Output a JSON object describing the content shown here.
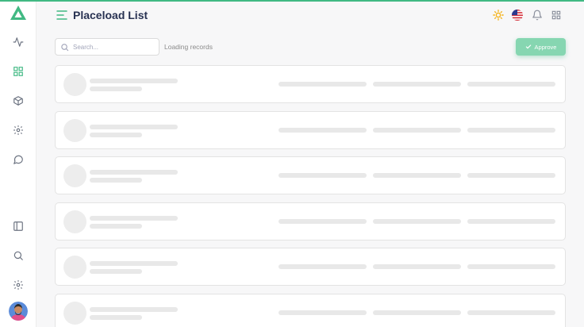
{
  "app": {
    "page_title": "Placeload List",
    "accent_color": "#41b983",
    "approve_color": "#86d6b1"
  },
  "sidebar": {
    "top_items": [
      {
        "icon": "activity-icon"
      },
      {
        "icon": "grid-icon"
      },
      {
        "icon": "box-icon"
      },
      {
        "icon": "settings-icon"
      },
      {
        "icon": "message-icon"
      }
    ],
    "bottom_items": [
      {
        "icon": "sidebar-panel-icon"
      },
      {
        "icon": "search-icon"
      },
      {
        "icon": "settings-icon"
      }
    ],
    "avatar": "user-avatar"
  },
  "header": {
    "menu_icon": "menu-icon",
    "actions": [
      "sun-icon",
      "us-flag-icon",
      "bell-icon",
      "apps-grid-icon"
    ]
  },
  "toolbar": {
    "search_placeholder": "Search...",
    "search_value": "",
    "status_text": "Loading records",
    "approve_label": "Approve"
  },
  "list": {
    "rows": [
      {
        "state": "loading"
      },
      {
        "state": "loading"
      },
      {
        "state": "loading"
      },
      {
        "state": "loading"
      },
      {
        "state": "loading"
      },
      {
        "state": "loading"
      }
    ]
  }
}
